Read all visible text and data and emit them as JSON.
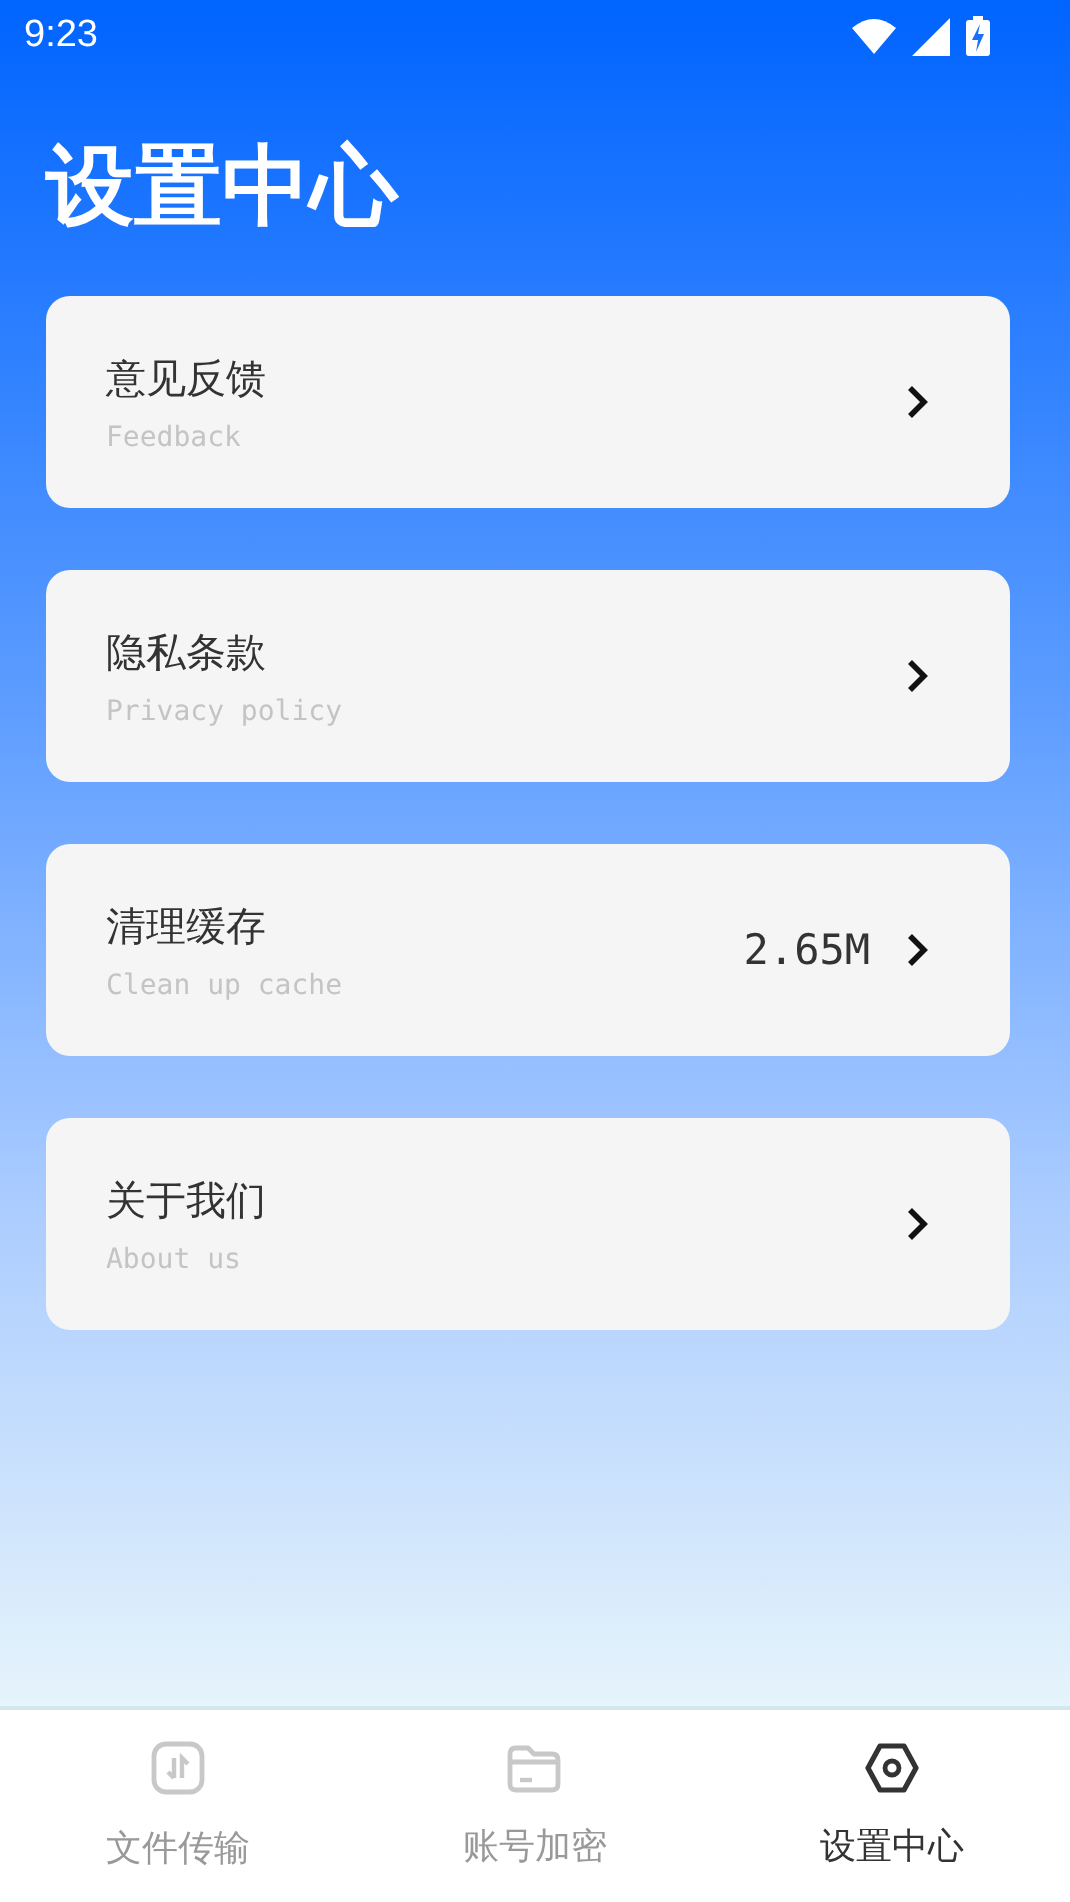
{
  "status_bar": {
    "time": "9:23"
  },
  "title": "设置中心",
  "items": [
    {
      "title": "意见反馈",
      "subtitle": "Feedback"
    },
    {
      "title": "隐私条款",
      "subtitle": "Privacy policy"
    },
    {
      "title": "清理缓存",
      "subtitle": "Clean up cache",
      "value": "2.65M"
    },
    {
      "title": "关于我们",
      "subtitle": "About us"
    }
  ],
  "nav": [
    {
      "kind": "transfer",
      "label": "文件传输",
      "selected": false
    },
    {
      "kind": "folder",
      "label": "账号加密",
      "selected": false
    },
    {
      "kind": "settings",
      "label": "设置中心",
      "selected": true
    }
  ]
}
